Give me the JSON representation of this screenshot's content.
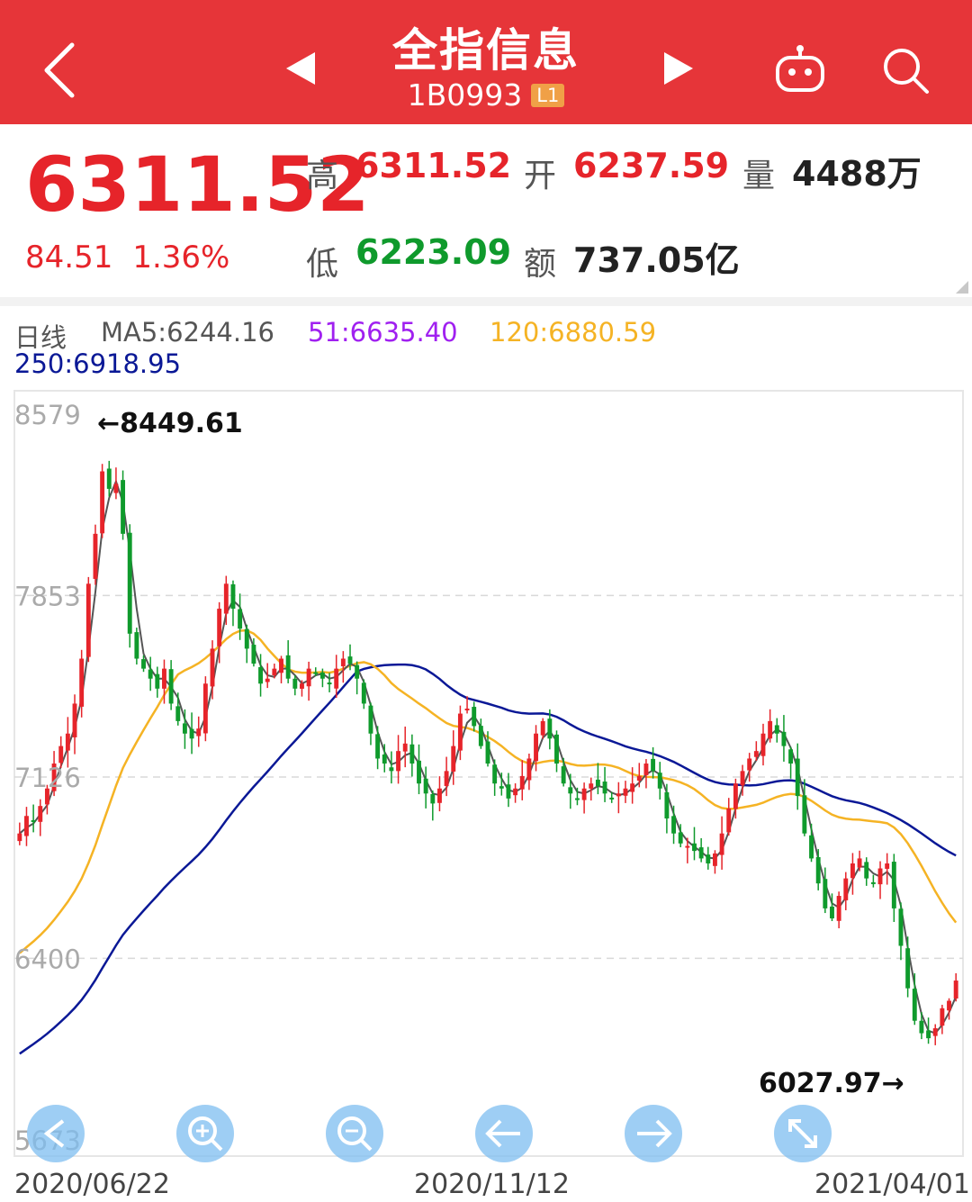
{
  "header": {
    "title": "全指信息",
    "code": "1B0993",
    "level_badge": "L1",
    "bg_color": "#e63539"
  },
  "quote": {
    "price": "6311.52",
    "change": "84.51",
    "change_pct": "1.36%",
    "high_label": "高",
    "high": "6311.52",
    "open_label": "开",
    "open": "6237.59",
    "volume_label": "量",
    "volume": "4488万",
    "low_label": "低",
    "low": "6223.09",
    "amount_label": "额",
    "amount": "737.05亿"
  },
  "ma_legend": {
    "period": "日线",
    "ma5": "MA5:6244.16",
    "ma51": "51:6635.40",
    "ma120": "120:6880.59",
    "ma250": "250:6918.95"
  },
  "chart_data": {
    "type": "candlestick",
    "y_ticks": [
      "8579",
      "7853",
      "7126",
      "6400",
      "5673"
    ],
    "ylim": [
      5673,
      8579
    ],
    "x_ticks": [
      "2020/06/22",
      "2020/11/12",
      "2021/04/01"
    ],
    "annotations": {
      "high": "←8449.61",
      "low": "6027.97→"
    },
    "series_colors": {
      "up": "#e6242a",
      "down": "#0f9a2c",
      "ma5": "#555555",
      "ma51": "#a020f0",
      "ma120": "#f5b324",
      "ma250": "#0a1896"
    },
    "candle_closes": [
      6900,
      6970,
      6950,
      7010,
      7080,
      7180,
      7250,
      7300,
      7420,
      7600,
      7900,
      8100,
      8350,
      8280,
      8300,
      8100,
      7700,
      7600,
      7560,
      7520,
      7480,
      7560,
      7420,
      7350,
      7300,
      7280,
      7320,
      7500,
      7640,
      7800,
      7900,
      7800,
      7720,
      7640,
      7580,
      7500,
      7520,
      7560,
      7600,
      7520,
      7480,
      7500,
      7560,
      7540,
      7520,
      7500,
      7560,
      7600,
      7580,
      7520,
      7420,
      7300,
      7200,
      7180,
      7150,
      7230,
      7260,
      7180,
      7100,
      7060,
      7020,
      7080,
      7150,
      7250,
      7380,
      7400,
      7330,
      7250,
      7180,
      7100,
      7080,
      7040,
      7080,
      7130,
      7200,
      7300,
      7350,
      7280,
      7180,
      7100,
      7060,
      7040,
      7080,
      7100,
      7090,
      7060,
      7040,
      7060,
      7080,
      7100,
      7130,
      7180,
      7150,
      7080,
      6960,
      6900,
      6860,
      6850,
      6830,
      6800,
      6780,
      6820,
      6900,
      7000,
      7100,
      7150,
      7200,
      7230,
      7300,
      7350,
      7300,
      7250,
      7180,
      7050,
      6900,
      6800,
      6700,
      6600,
      6560,
      6650,
      6720,
      6780,
      6800,
      6720,
      6700,
      6760,
      6780,
      6600,
      6450,
      6280,
      6150,
      6100,
      6080,
      6120,
      6200,
      6230,
      6311
    ]
  }
}
